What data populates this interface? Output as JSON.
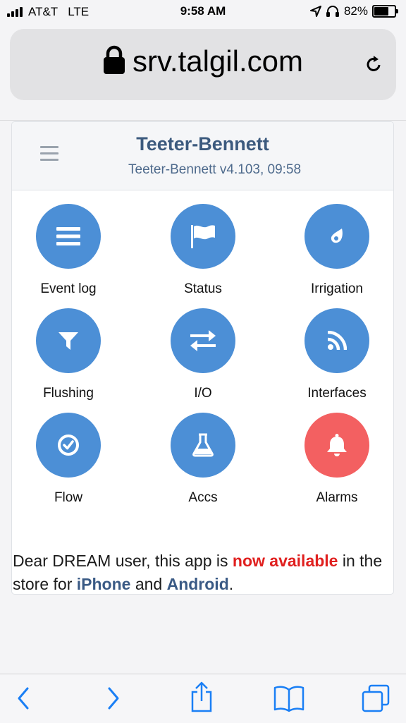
{
  "status_bar": {
    "carrier": "AT&T",
    "network": "LTE",
    "time": "9:58 AM",
    "battery": "82%",
    "battery_level": 0.82
  },
  "browser": {
    "url": "srv.talgil.com"
  },
  "header": {
    "title": "Teeter-Bennett",
    "subtitle": "Teeter-Bennett v4.103, 09:58"
  },
  "tiles": [
    {
      "label": "Event log",
      "icon": "list-icon"
    },
    {
      "label": "Status",
      "icon": "flag-icon"
    },
    {
      "label": "Irrigation",
      "icon": "drop-icon"
    },
    {
      "label": "Flushing",
      "icon": "filter-icon"
    },
    {
      "label": "I/O",
      "icon": "exchange-icon"
    },
    {
      "label": "Interfaces",
      "icon": "rss-icon"
    },
    {
      "label": "Flow",
      "icon": "clock-check-icon"
    },
    {
      "label": "Accs",
      "icon": "flask-icon"
    },
    {
      "label": "Alarms",
      "icon": "bell-icon"
    }
  ],
  "notice": {
    "part1": "Dear DREAM user, this app is ",
    "highlight": "now available",
    "part2": " in the store for ",
    "iphone": "iPhone",
    "part3": " and ",
    "android": "Android",
    "part4": "."
  },
  "colors": {
    "tile": "#4c8fd6",
    "alarm": "#f36061",
    "title": "#3c5a7e",
    "toolbar_icon": "#1a7ff5"
  }
}
